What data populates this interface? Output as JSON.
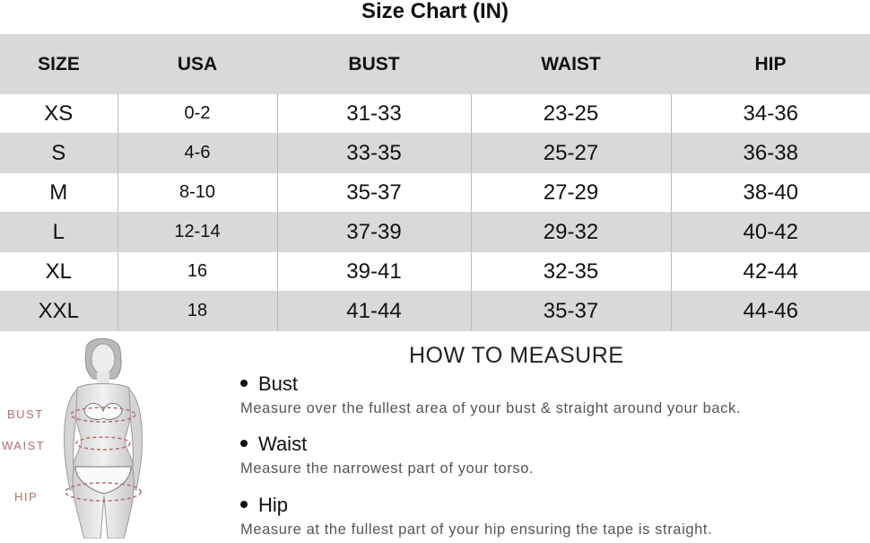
{
  "title": "Size Chart (IN)",
  "table": {
    "headers": [
      "SIZE",
      "USA",
      "BUST",
      "WAIST",
      "HIP"
    ],
    "rows": [
      [
        "XS",
        "0-2",
        "31-33",
        "23-25",
        "34-36"
      ],
      [
        "S",
        "4-6",
        "33-35",
        "25-27",
        "36-38"
      ],
      [
        "M",
        "8-10",
        "35-37",
        "27-29",
        "38-40"
      ],
      [
        "L",
        "12-14",
        "37-39",
        "29-32",
        "40-42"
      ],
      [
        "XL",
        "16",
        "39-41",
        "32-35",
        "42-44"
      ],
      [
        "XXL",
        "18",
        "41-44",
        "35-37",
        "44-46"
      ]
    ]
  },
  "figure": {
    "labels": {
      "bust": "BUST",
      "waist": "WAIST",
      "hip": "HIP"
    },
    "accent_color": "#b0706d"
  },
  "how_to_measure": {
    "title": "HOW TO MEASURE",
    "items": [
      {
        "name": "Bust",
        "desc": "Measure over the fullest area of your bust & straight around your back."
      },
      {
        "name": "Waist",
        "desc": "Measure the narrowest part of your torso."
      },
      {
        "name": "Hip",
        "desc": "Measure at the fullest part of your hip ensuring the tape is straight."
      }
    ]
  },
  "colors": {
    "row_gray": "#d9d9d9",
    "row_white": "#ffffff"
  }
}
